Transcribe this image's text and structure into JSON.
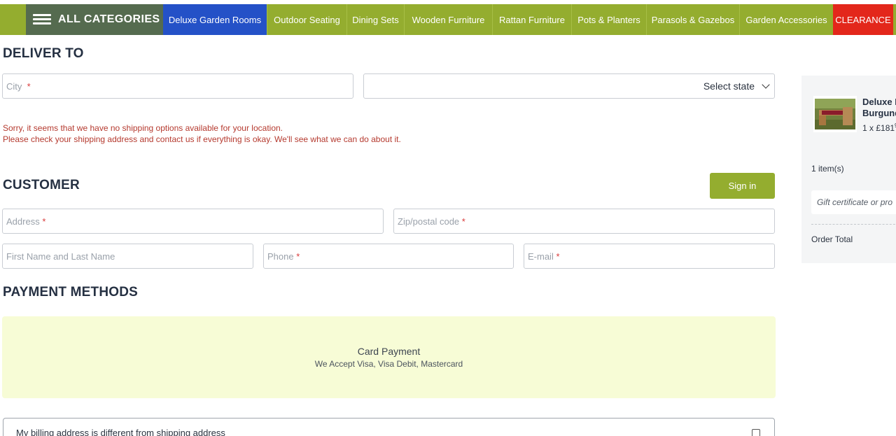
{
  "nav": {
    "all_categories": "ALL CATEGORIES",
    "items": [
      {
        "label": "Deluxe Garden Rooms",
        "state": "active"
      },
      {
        "label": "Outdoor Seating"
      },
      {
        "label": "Dining Sets"
      },
      {
        "label": "Wooden Furniture"
      },
      {
        "label": "Rattan Furniture"
      },
      {
        "label": "Pots & Planters"
      },
      {
        "label": "Parasols & Gazebos"
      },
      {
        "label": "Garden Accessories"
      },
      {
        "label": "CLEARANCE",
        "state": "highlight"
      }
    ]
  },
  "deliver": {
    "title": "DELIVER TO",
    "city_placeholder": "City",
    "state_select": "Select state",
    "warning_line1": "Sorry, it seems that we have no shipping options available for your location.",
    "warning_line2": "Please check your shipping address and contact us if everything is okay. We'll see what we can do about it."
  },
  "customer": {
    "title": "CUSTOMER",
    "sign_in": "Sign in",
    "address_placeholder": "Address",
    "zip_placeholder": "Zip/postal code",
    "name_placeholder": "First Name and Last Name",
    "phone_placeholder": "Phone",
    "email_placeholder": "E-mail",
    "required_mark": "*"
  },
  "payment": {
    "title": "PAYMENT METHODS",
    "card_title": "Card Payment",
    "card_subtitle": "We Accept Visa, Visa Debit, Mastercard",
    "billing_label": "My billing address is different from shipping address"
  },
  "sidebar": {
    "product_name_line1": "Deluxe I",
    "product_name_line2": "Burgund",
    "product_qty": "1 x £181",
    "product_qty_sup": "9",
    "items_count": "1 item(s)",
    "gift_placeholder": "Gift certificate or pro",
    "order_total_label": "Order Total"
  },
  "colors": {
    "brand_green": "#94ad2f",
    "dark_green": "#556b4f",
    "active_blue": "#2451c7",
    "clearance_red": "#e3271b",
    "card_bg": "#f7fcd6"
  }
}
